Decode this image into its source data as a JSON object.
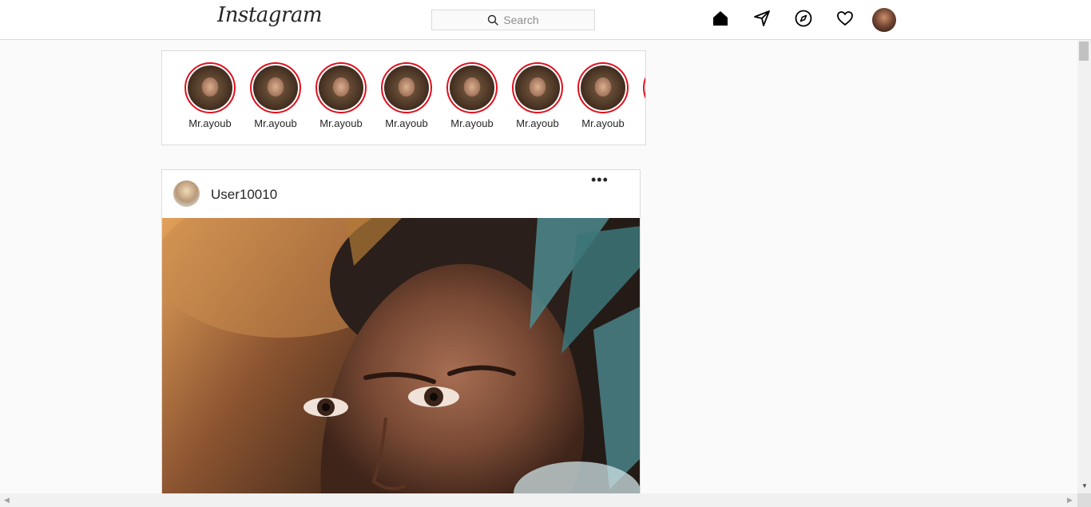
{
  "header": {
    "logo": "Instagram",
    "search_placeholder": "Search",
    "icons": [
      "home-icon",
      "direct-message-icon",
      "explore-icon",
      "heart-icon",
      "profile-avatar"
    ]
  },
  "stories": [
    {
      "name": "Mr.ayoub"
    },
    {
      "name": "Mr.ayoub"
    },
    {
      "name": "Mr.ayoub"
    },
    {
      "name": "Mr.ayoub"
    },
    {
      "name": "Mr.ayoub"
    },
    {
      "name": "Mr.ayoub"
    },
    {
      "name": "Mr.ayoub"
    },
    {
      "name": ""
    }
  ],
  "post": {
    "username": "User10010",
    "more": "•••"
  },
  "colors": {
    "story_ring": "#e0101e",
    "border": "#dbdbdb",
    "background": "#fafafa"
  }
}
